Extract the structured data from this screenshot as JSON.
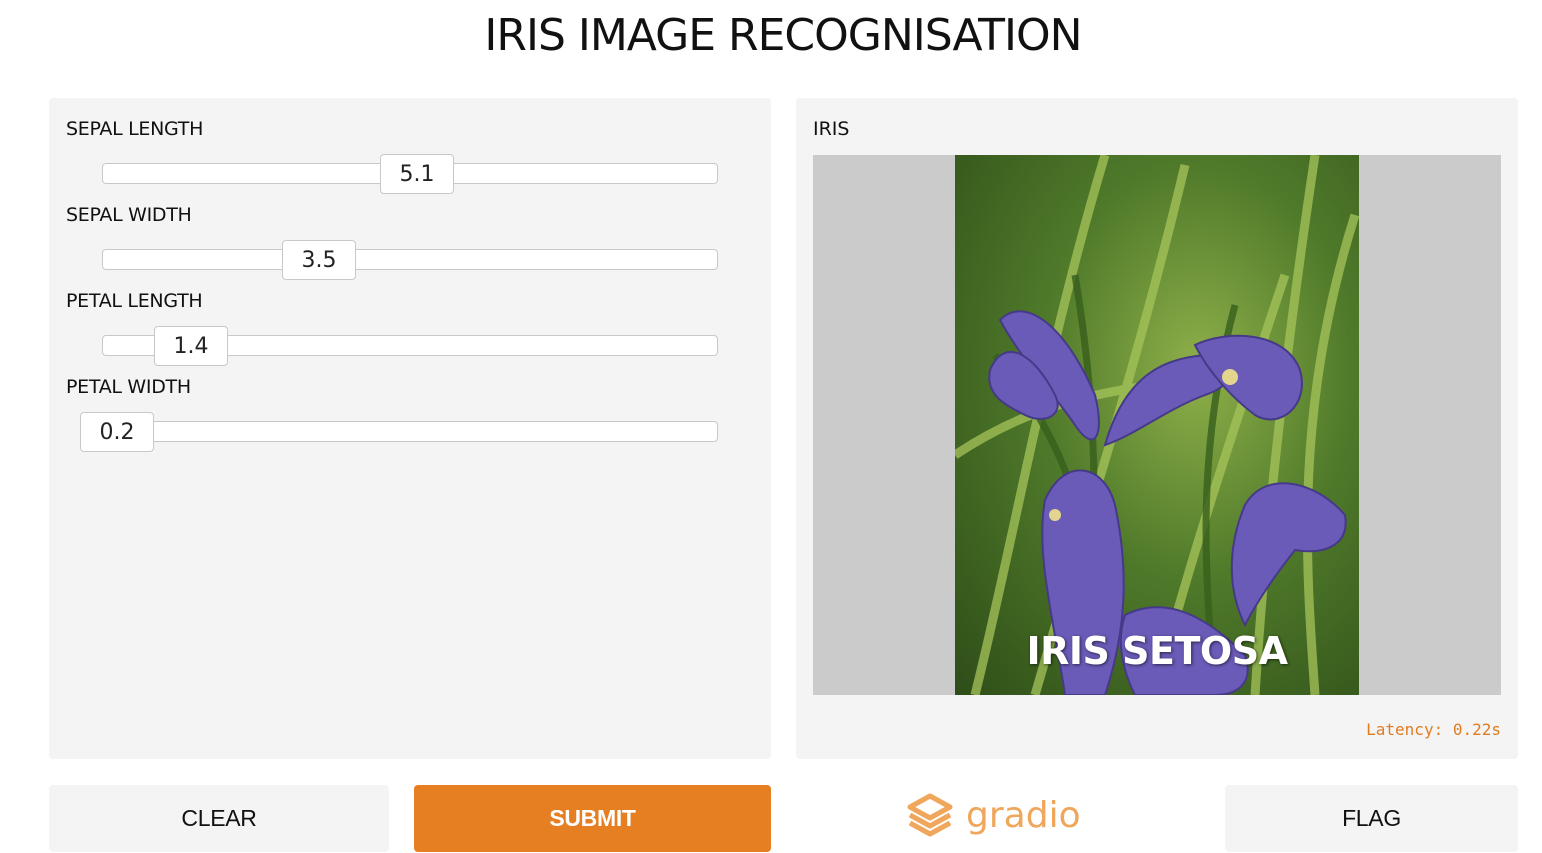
{
  "header": {
    "title": "IRIS IMAGE RECOGNISATION"
  },
  "inputs": {
    "sliders": [
      {
        "label": "SEPAL LENGTH",
        "value": "5.1",
        "fraction": 0.45
      },
      {
        "label": "SEPAL WIDTH",
        "value": "3.5",
        "fraction": 0.295
      },
      {
        "label": "PETAL LENGTH",
        "value": "1.4",
        "fraction": 0.085
      },
      {
        "label": "PETAL WIDTH",
        "value": "0.2",
        "fraction": 0.0
      }
    ]
  },
  "output": {
    "label": "IRIS",
    "caption": "IRIS SETOSA",
    "latency": "Latency: 0.22s"
  },
  "actions": {
    "clear_label": "CLEAR",
    "submit_label": "SUBMIT",
    "flag_label": "FLAG"
  },
  "brand": {
    "name": "gradio",
    "icon": "gradio-logo-icon"
  },
  "colors": {
    "accent": "#e67e22",
    "latency": "#e07c22",
    "panel": "#f4f4f4"
  }
}
